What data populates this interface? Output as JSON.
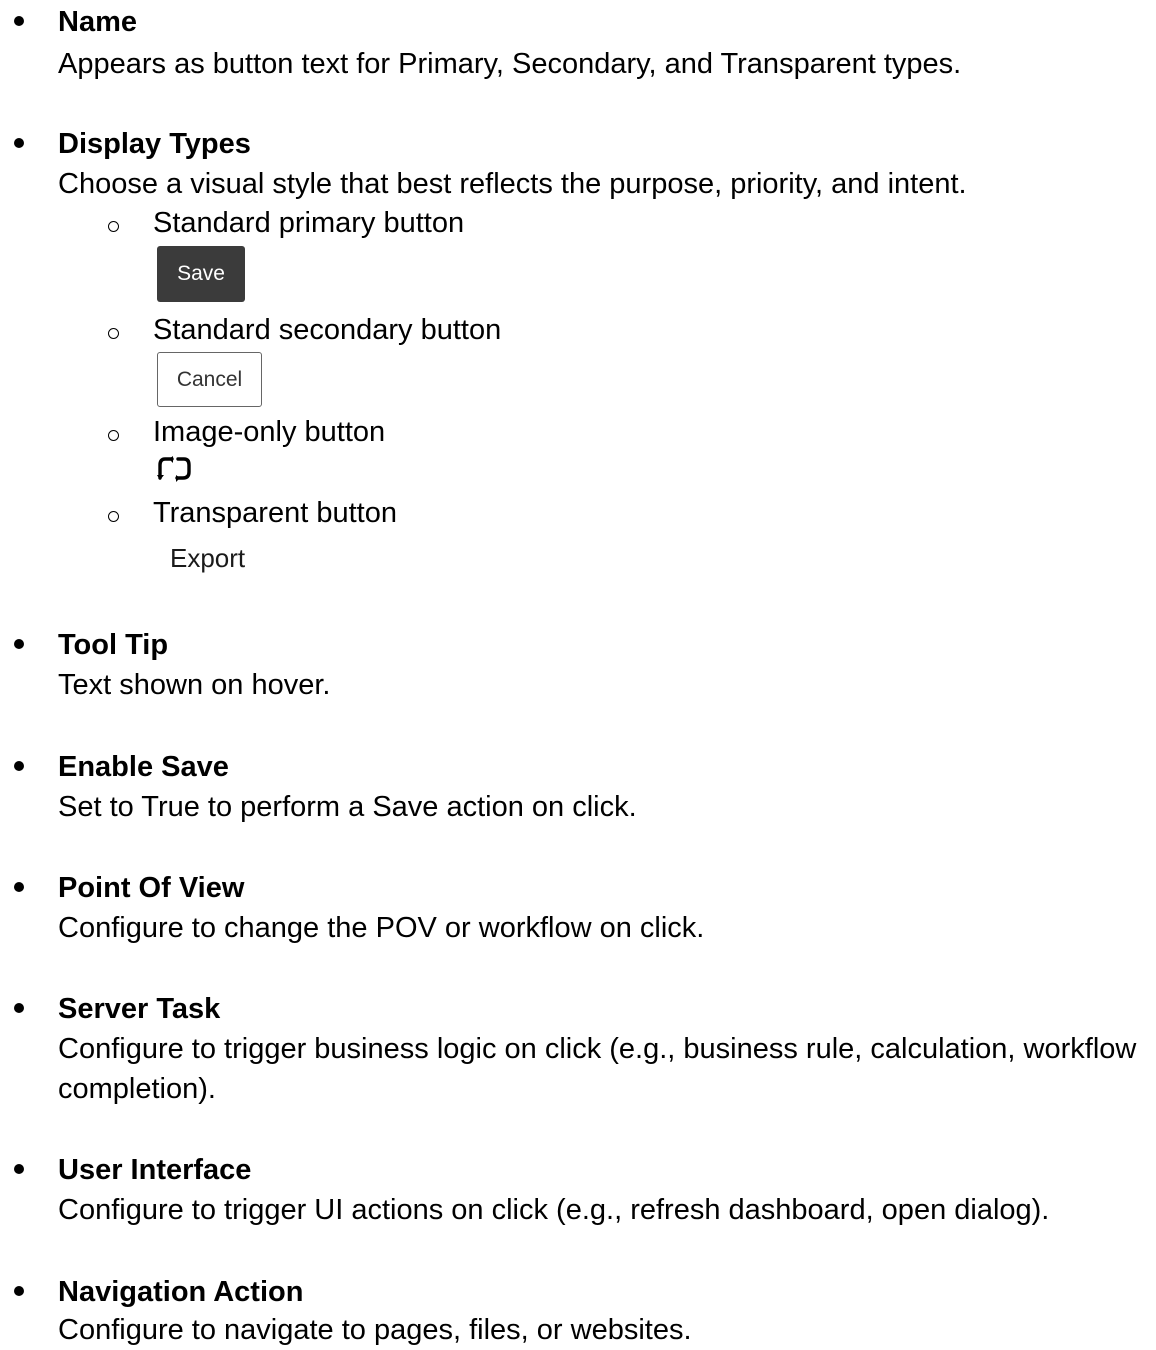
{
  "items": [
    {
      "title": "Name",
      "desc": "Appears as button text for Primary, Secondary, and Transparent types."
    },
    {
      "title": "Display Types",
      "desc": "Choose a visual style that best reflects the purpose, priority, and intent.",
      "subitems": [
        {
          "label": "Standard primary button",
          "sample": "Save"
        },
        {
          "label": "Standard secondary button",
          "sample": "Cancel"
        },
        {
          "label": "Image-only button",
          "sample_icon": "refresh-icon"
        },
        {
          "label": "Transparent button",
          "sample": "Export"
        }
      ]
    },
    {
      "title": "Tool Tip",
      "desc": "Text shown on hover."
    },
    {
      "title": "Enable Save",
      "desc": "Set to True to perform a Save action on click."
    },
    {
      "title": "Point Of View",
      "desc": "Configure to change the POV or workflow on click."
    },
    {
      "title": "Server Task",
      "desc": "Configure to trigger business logic on click (e.g., business rule, calculation, workflow completion)."
    },
    {
      "title": "User Interface",
      "desc": "Configure to trigger UI actions on click (e.g., refresh dashboard, open dialog)."
    },
    {
      "title": "Navigation Action",
      "desc": "Configure to navigate to pages, files, or websites."
    }
  ]
}
